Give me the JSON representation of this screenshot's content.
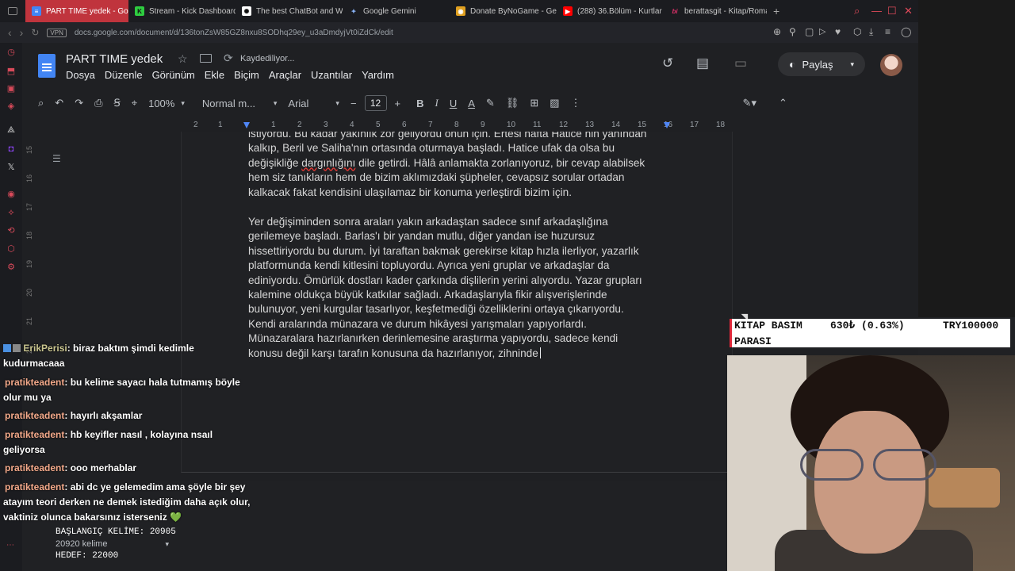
{
  "browser": {
    "tabs": [
      {
        "label": "PART TIME yedek - Google",
        "icon": "google-docs-icon",
        "active": true
      },
      {
        "label": "Stream - Kick Dashboard",
        "icon": "kick-icon"
      },
      {
        "label": "The best ChatBot and W",
        "icon": "chatgpt-icon"
      },
      {
        "label": "Google Gemini",
        "icon": "gemini-icon"
      },
      {
        "label": "Donate ByNoGame - Gele",
        "icon": "bynogame-icon"
      },
      {
        "label": "(288) 36.Bölüm - Kurtlar",
        "icon": "youtube-icon"
      },
      {
        "label": "berattasgit - Kitap/Roman",
        "icon": "bi-icon"
      }
    ],
    "url": "docs.google.com/document/d/136tonZsW85GZ8nxu8SODhq29ey_u3aDmdyjVt0iZdCk/edit",
    "vpn_label": "VPN"
  },
  "docs": {
    "title": "PART TIME  yedek",
    "save_status": "Kaydediliyor...",
    "menu": [
      "Dosya",
      "Düzenle",
      "Görünüm",
      "Ekle",
      "Biçim",
      "Araçlar",
      "Uzantılar",
      "Yardım"
    ],
    "share_label": "Paylaş",
    "toolbar": {
      "zoom": "100%",
      "style": "Normal m...",
      "font": "Arial",
      "font_size": "12"
    },
    "ruler": [
      "2",
      "1",
      "1",
      "2",
      "3",
      "4",
      "5",
      "6",
      "7",
      "8",
      "9",
      "10",
      "11",
      "12",
      "13",
      "14",
      "15",
      "16",
      "17",
      "18"
    ],
    "vertical_ruler": [
      "15",
      "16",
      "17",
      "18",
      "19",
      "20",
      "21",
      "22"
    ],
    "paragraph1": [
      "istiyordu. Bu kadar yakınlık zor geliyordu onun için. Ertesi hafta Hatice nin yanından",
      "kalkıp, Beril ve Saliha'nın ortasında oturmaya başladı. Hatice ufak da olsa bu",
      "değişikliğe",
      "dargınlığını",
      "dile getirdi. Hâlâ anlamakta zorlanıyoruz, bir cevap alabilsek",
      "hem siz tanıkların hem de bizim aklımızdaki şüpheler, cevapsız sorular ortadan",
      "kalkacak fakat kendisini ulaşılamaz bir konuma yerleştirdi bizim için."
    ],
    "paragraph2": [
      "Yer değişiminden sonra araları yakın arkadaştan sadece sınıf arkadaşlığına",
      "gerilemeye başladı. Barlas'ı bir yandan mutlu, diğer yandan ise huzursuz",
      "hissettiriyordu bu durum. İyi taraftan bakmak gerekirse kitap hızla ilerliyor, yazarlık",
      "platformunda kendi kitlesini topluyordu. Ayrıca yeni gruplar ve arkadaşlar da",
      "ediniyordu. Ömürlük dostları kader çarkında dişlilerin yerini alıyordu. Yazar grupları",
      "kalemine oldukça büyük katkılar sağladı. Arkadaşlarıyla fikir alışverişlerinde",
      "bulunuyor, yeni kurgular tasarlıyor, keşfetmediği özelliklerini ortaya çıkarıyordu.",
      "Kendi aralarında münazara ve durum hikâyesi yarışmaları yapıyorlardı.",
      "Münazaralara hazırlanırken derinlemesine araştırma yapıyordu, sadece kendi",
      "konusu değil karşı tarafın konusuna da hazırlanıyor, zihninde"
    ]
  },
  "ticker": {
    "label_line1": "KITAP BASIM",
    "label_line2": "PARASI",
    "amount": "630₺ (0.63%)",
    "goal": "TRY100000",
    "accent": "#e0283a"
  },
  "chat": [
    {
      "user": "ErikPerisi",
      "text": ": biraz baktım şimdi kedimle",
      "text2": "kudurmacaaa"
    },
    {
      "user": "pratikteadent",
      "text": ": bu kelime sayacı hala tutmamış böyle",
      "text2": "olur mu ya"
    },
    {
      "user": "pratikteadent",
      "text": ": hayırlı akşamlar",
      "text2": ""
    },
    {
      "user": "pratikteadent",
      "text": ": hb keyifler nasıl , kolayına nsaıl",
      "text2": "geliyorsa"
    },
    {
      "user": "pratikteadent",
      "text": ": ooo merhablar",
      "text2": ""
    },
    {
      "user": "pratikteadent",
      "text": ": abi dc ye gelemedim ama şöyle bir şey",
      "text2": "atayım teori derken ne demek istediğim daha açık olur,",
      "text3": "vaktiniz olunca bakarsınız isterseniz",
      "emoji": "💚"
    }
  ],
  "word_overlay": {
    "start": "BAŞLANGIÇ KELİME: 20905",
    "count": "20920 kelime",
    "target": "HEDEF: 22000"
  },
  "colors": {
    "tab_active": "#c0343d",
    "docs_bg": "#1f2023",
    "text": "#d6d6d6",
    "link_blue": "#4285f4"
  }
}
